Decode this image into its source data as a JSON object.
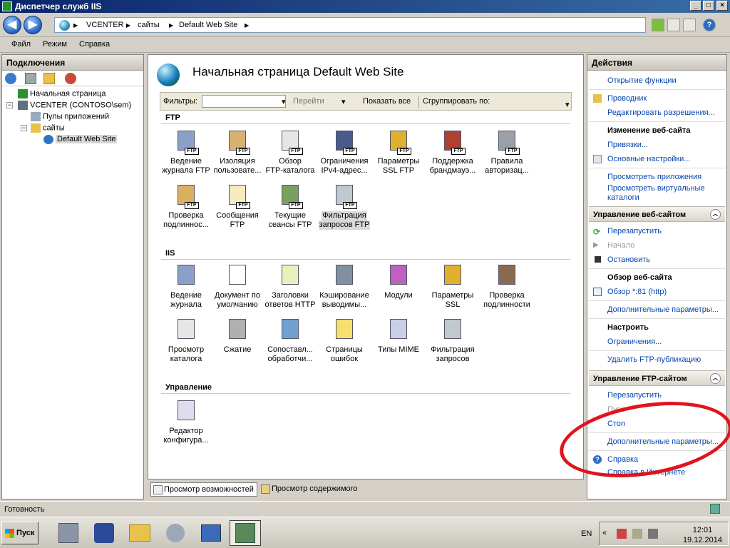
{
  "window": {
    "title": "Диспетчер служб IIS",
    "min": "_",
    "max": "□",
    "close": "×"
  },
  "address": {
    "back": "◀",
    "forward": "▶",
    "crumbs": [
      "VCENTER",
      "сайты",
      "Default Web Site"
    ],
    "sep": "▶",
    "help": "?"
  },
  "menu": [
    "Файл",
    "Режим",
    "Справка"
  ],
  "connections": {
    "header": "Подключения",
    "tree": {
      "start": "Начальная страница",
      "server": "VCENTER (CONTOSO\\sem)",
      "pools": "Пулы приложений",
      "sites": "сайты",
      "site": "Default Web Site",
      "collapse": "−"
    }
  },
  "center": {
    "title": "Начальная страница Default Web Site",
    "filter_label": "Фильтры:",
    "go": "Перейти",
    "show_all": "Показать все",
    "group_by": "Сгруппировать по:",
    "dropdown": "▾",
    "sections": {
      "ftp": "FTP",
      "iis": "IIS",
      "mgmt": "Управление"
    },
    "ftp_badge": "FTP",
    "ftp_items": [
      [
        "Ведение",
        "журнала FTP"
      ],
      [
        "Изоляция",
        "пользовате..."
      ],
      [
        "Обзор",
        "FTP-каталога"
      ],
      [
        "Ограничения",
        "IPv4-адрес..."
      ],
      [
        "Параметры",
        "SSL FTP"
      ],
      [
        "Поддержка",
        "брандмауэ..."
      ],
      [
        "Правила",
        "авторизац..."
      ],
      [
        "Проверка",
        "подлиннос..."
      ],
      [
        "Сообщения",
        "FTP"
      ],
      [
        "Текущие",
        "сеансы FTP"
      ],
      [
        "Фильтрация",
        "запросов FTP"
      ]
    ],
    "iis_items": [
      [
        "Ведение",
        "журнала"
      ],
      [
        "Документ по",
        "умолчанию"
      ],
      [
        "Заголовки",
        "ответов HTTP"
      ],
      [
        "Кэширование",
        "выводимы..."
      ],
      [
        "Модули",
        ""
      ],
      [
        "Параметры",
        "SSL"
      ],
      [
        "Проверка",
        "подлинности"
      ],
      [
        "Просмотр",
        "каталога"
      ],
      [
        "Сжатие",
        ""
      ],
      [
        "Сопоставл...",
        "обработчи..."
      ],
      [
        "Страницы",
        "ошибок"
      ],
      [
        "Типы MIME",
        ""
      ],
      [
        "Фильтрация",
        "запросов"
      ]
    ],
    "mgmt_items": [
      [
        "Редактор",
        "конфигура..."
      ]
    ],
    "tabs": [
      "Просмотр возможностей",
      "Просмотр содержимого"
    ]
  },
  "actions": {
    "header": "Действия",
    "open_feature": "Открытие функции",
    "explorer": "Проводник",
    "edit_perms": "Редактировать разрешения...",
    "edit_site": "Изменение веб-сайта",
    "bindings": "Привязки...",
    "basic_settings": "Основные настройки...",
    "view_apps": "Просмотреть приложения",
    "view_vdirs_1": "Просмотреть виртуальные",
    "view_vdirs_2": "каталоги",
    "manage_site": "Управление веб-сайтом",
    "restart": "Перезапустить",
    "start": "Начало",
    "stop": "Остановить",
    "browse_site": "Обзор веб-сайта",
    "browse_port": "Обзор *:81 (http)",
    "advanced": "Дополнительные параметры...",
    "configure": "Настроить",
    "limits": "Ограничения...",
    "remove_ftp": "Удалить FTP-публикацию",
    "manage_ftp": "Управление FTP-сайтом",
    "ftp_restart": "Перезапустить",
    "ftp_start": "Пуск",
    "ftp_stop": "Стоп",
    "ftp_advanced": "Дополнительные параметры...",
    "help": "Справка",
    "help_online": "Справка в Интернете",
    "collapse": "︿"
  },
  "status": "Готовность",
  "taskbar": {
    "start": "Пуск",
    "lang": "EN",
    "time": "12:01",
    "date": "19.12.2014",
    "tray_arrow": "«"
  },
  "colors": {
    "annotation": "#e0141c",
    "link": "#0645ad",
    "titlebar": "#0a246a"
  }
}
